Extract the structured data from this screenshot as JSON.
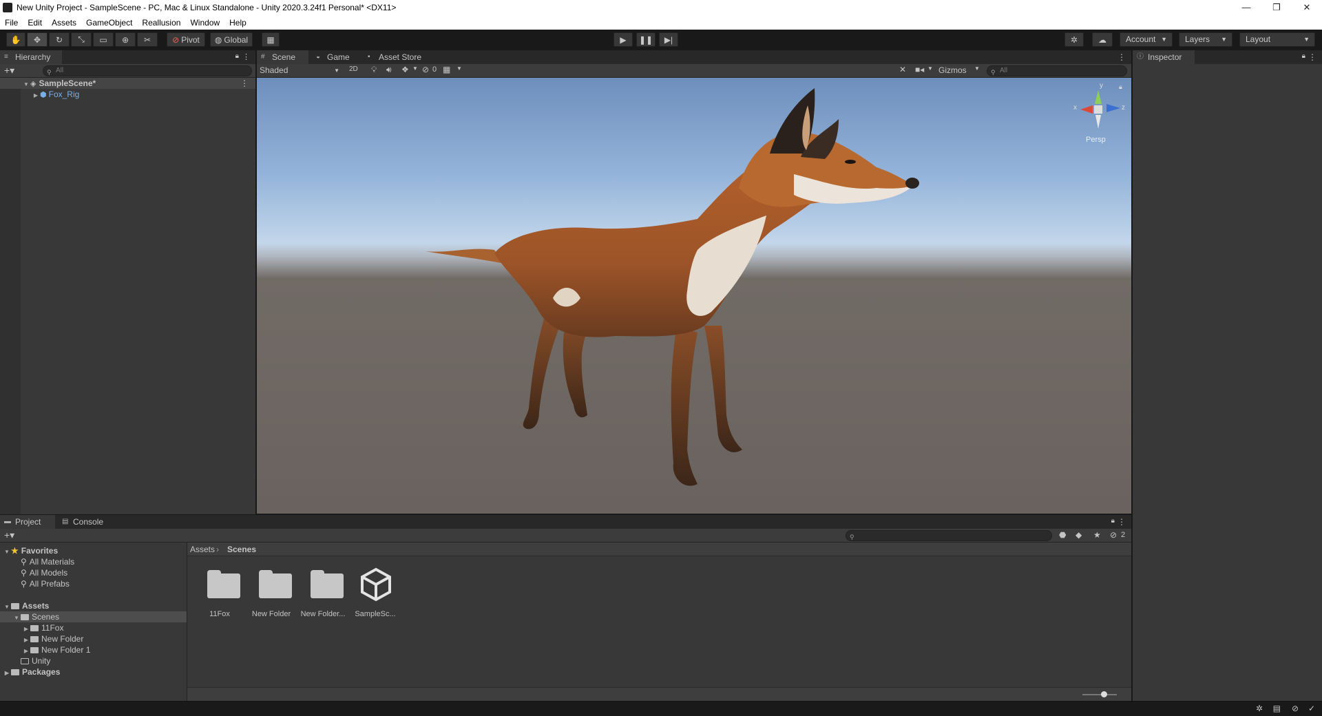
{
  "window": {
    "title": "New Unity Project - SampleScene - PC, Mac & Linux Standalone - Unity 2020.3.24f1 Personal* <DX11>",
    "min": "—",
    "max": "❐",
    "close": "✕"
  },
  "menu": [
    "File",
    "Edit",
    "Assets",
    "GameObject",
    "Reallusion",
    "Window",
    "Help"
  ],
  "toolbar": {
    "tools": [
      "hand-tool",
      "move-tool",
      "rotate-tool",
      "scale-tool",
      "rect-tool",
      "transform-tool",
      "custom-tool"
    ],
    "pivot": "Pivot",
    "global": "Global",
    "account": "Account",
    "layers": "Layers",
    "layout": "Layout"
  },
  "hierarchy": {
    "tab": "Hierarchy",
    "search_placeholder": "All",
    "scene": "SampleScene*",
    "items": [
      "Fox_Rig"
    ]
  },
  "scene_view": {
    "tabs": [
      "Scene",
      "Game",
      "Asset Store"
    ],
    "shading": "Shaded",
    "mode2d": "2D",
    "hidden_count": "0",
    "gizmos": "Gizmos",
    "search_placeholder": "All",
    "gizmo_axes": {
      "x": "x",
      "y": "y",
      "z": "z"
    },
    "projection": "Persp"
  },
  "inspector": {
    "tab": "Inspector"
  },
  "project": {
    "tabs": [
      "Project",
      "Console"
    ],
    "favorites_label": "Favorites",
    "favorites": [
      "All Materials",
      "All Models",
      "All Prefabs"
    ],
    "assets_label": "Assets",
    "tree": [
      "Scenes",
      "11Fox",
      "New Folder",
      "New Folder 1",
      "Unity"
    ],
    "packages_label": "Packages",
    "breadcrumb": [
      "Assets",
      "Scenes"
    ],
    "hidden_count": "2",
    "assets": [
      "11Fox",
      "New Folder",
      "New Folder...",
      "SampleSc..."
    ]
  }
}
